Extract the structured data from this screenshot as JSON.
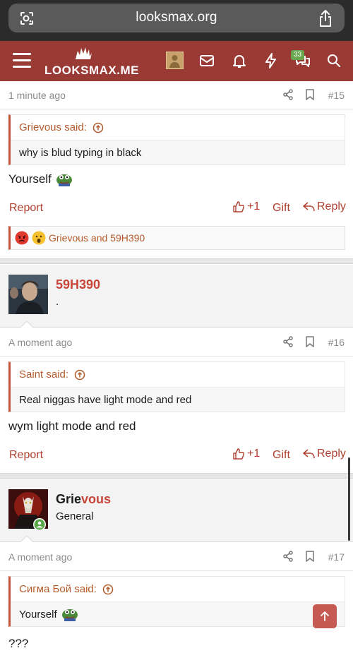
{
  "browser": {
    "url": "looksmax.org"
  },
  "header": {
    "logo_text": "LOOKSMAX.ME",
    "conversations_badge": "33"
  },
  "posts": [
    {
      "time": "1 minute ago",
      "number": "#15",
      "quote_author": "Grievous said:",
      "quote_text": "why is blud typing in black",
      "body": "Yourself",
      "report": "Report",
      "like": "+1",
      "gift": "Gift",
      "reply": "Reply",
      "reactions_text": "Grievous and 59H390"
    },
    {
      "username": "59H390",
      "user_sub": ".",
      "time": "A moment ago",
      "number": "#16",
      "quote_author": "Saint said:",
      "quote_text": "Real niggas have light mode and red",
      "body": "wym light mode and red",
      "report": "Report",
      "like": "+1",
      "gift": "Gift",
      "reply": "Reply"
    },
    {
      "username_part1": "Grie",
      "username_part2": "vous",
      "user_title": "General",
      "time": "A moment ago",
      "number": "#17",
      "quote_author": "Сигма Бой said:",
      "quote_text": "Yourself",
      "body": "???"
    }
  ],
  "colors": {
    "header_bg": "#9a3a34",
    "accent": "#b0402f",
    "username": "#c8453a",
    "quote_author": "#b35a2b"
  }
}
